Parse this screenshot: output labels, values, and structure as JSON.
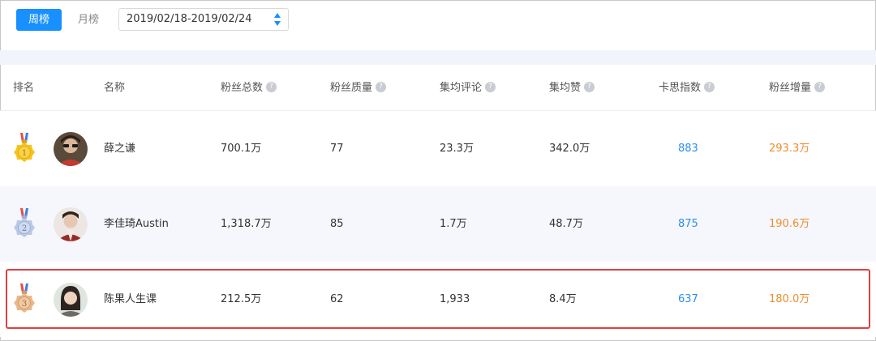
{
  "tabs": {
    "week": "周榜",
    "month": "月榜",
    "active": "week"
  },
  "date_range": "2019/02/18-2019/02/24",
  "columns": {
    "rank": "排名",
    "name": "名称",
    "fans_total": "粉丝总数",
    "fans_quality": "粉丝质量",
    "avg_comments": "集均评论",
    "avg_likes": "集均赞",
    "kasi_index": "卡思指数",
    "fans_growth": "粉丝增量",
    "help_glyph": "?"
  },
  "rows": [
    {
      "rank": "1",
      "name": "薛之谦",
      "fans_total": "700.1万",
      "fans_quality": "77",
      "avg_comments": "23.3万",
      "avg_likes": "342.0万",
      "kasi_index": "883",
      "fans_growth": "293.3万",
      "medal": "gold-medal-icon"
    },
    {
      "rank": "2",
      "name": "李佳琦Austin",
      "fans_total": "1,318.7万",
      "fans_quality": "85",
      "avg_comments": "1.7万",
      "avg_likes": "48.7万",
      "kasi_index": "875",
      "fans_growth": "190.6万",
      "medal": "silver-medal-icon"
    },
    {
      "rank": "3",
      "name": "陈果人生课",
      "fans_total": "212.5万",
      "fans_quality": "62",
      "avg_comments": "1,933",
      "avg_likes": "8.4万",
      "kasi_index": "637",
      "fans_growth": "180.0万",
      "medal": "bronze-medal-icon"
    }
  ],
  "colors": {
    "accent": "#1890ff",
    "index_blue": "#2b8ff0",
    "growth_orange": "#f08d2c",
    "highlight_red": "#e0413f",
    "gold": "#f7c31b",
    "silver": "#b9c8e6",
    "bronze": "#e9b889"
  }
}
